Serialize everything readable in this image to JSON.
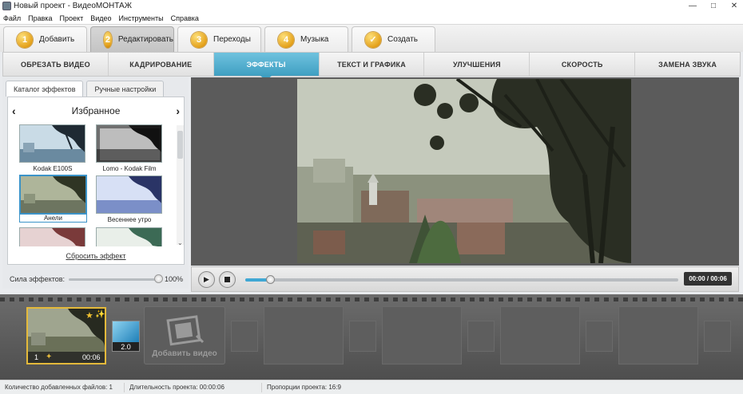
{
  "window": {
    "title": "Новый проект - ВидеоМОНТАЖ"
  },
  "menu": [
    "Файл",
    "Правка",
    "Проект",
    "Видео",
    "Инструменты",
    "Справка"
  ],
  "steps": [
    {
      "num": "1",
      "label": "Добавить"
    },
    {
      "num": "2",
      "label": "Редактировать"
    },
    {
      "num": "3",
      "label": "Переходы"
    },
    {
      "num": "4",
      "label": "Музыка"
    },
    {
      "num": "✓",
      "label": "Создать"
    }
  ],
  "tabs": [
    "ОБРЕЗАТЬ ВИДЕО",
    "КАДРИРОВАНИЕ",
    "ЭФФЕКТЫ",
    "ТЕКСТ И ГРАФИКА",
    "УЛУЧШЕНИЯ",
    "СКОРОСТЬ",
    "ЗАМЕНА ЗВУКА"
  ],
  "effects_panel": {
    "tab_catalog": "Каталог эффектов",
    "tab_manual": "Ручные настройки",
    "prev": "‹",
    "next": "›",
    "category": "Избранное",
    "items": [
      "Kodak E100S",
      "Lomo - Kodak Film",
      "Анели",
      "Весеннее утро"
    ],
    "reset": "Сбросить эффект",
    "strength_label": "Сила эффектов:",
    "strength_value": "100%"
  },
  "player": {
    "time": "00:00 / 00:06",
    "progress": 0.05
  },
  "timeline": {
    "clip_number": "1",
    "clip_duration": "00:06",
    "transition_duration": "2.0",
    "add_video": "Добавить видео"
  },
  "status": {
    "files": "Количество добавленных файлов: 1",
    "duration": "Длительность проекта: 00:00:06",
    "ratio": "Пропорции проекта: 16:9"
  },
  "colors": {
    "accent": "#3f9fc2",
    "step_badge": "#e4a11b",
    "clip_border": "#e4b93b"
  }
}
